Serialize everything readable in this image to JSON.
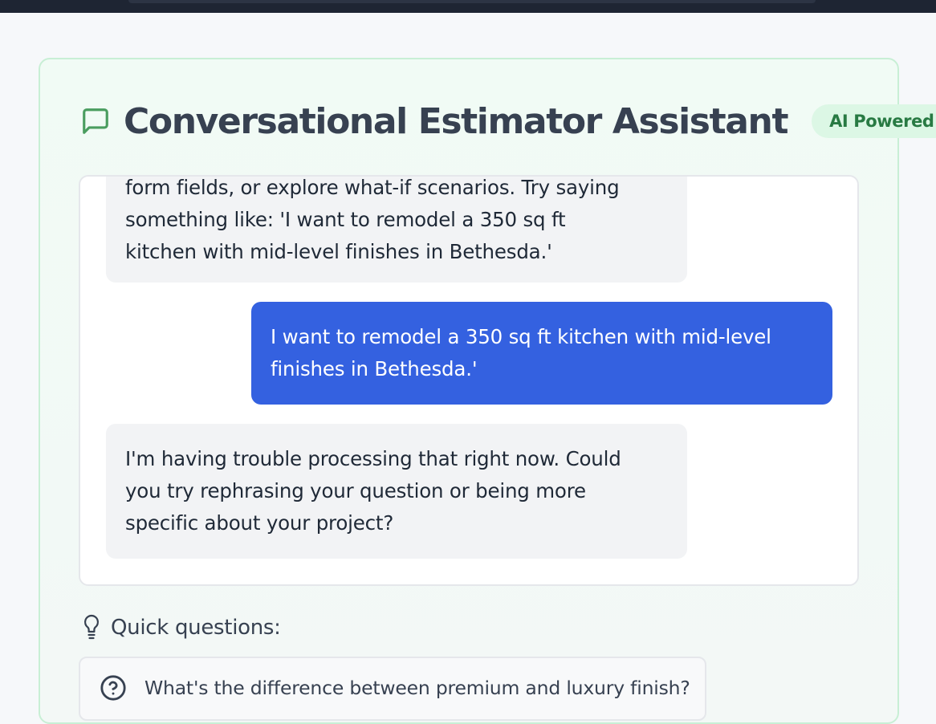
{
  "header": {
    "title": "Conversational Estimator Assistant",
    "badge": "AI Powered",
    "icon": "message-square-icon"
  },
  "chat": {
    "messages": [
      {
        "role": "assistant",
        "lines": [
          "form fields, or explore what-if scenarios. Try saying",
          "something like: 'I want to remodel a 350 sq ft",
          "kitchen with mid-level finishes in Bethesda.'"
        ]
      },
      {
        "role": "user",
        "lines": [
          "I want to remodel a 350 sq ft kitchen with mid-level",
          "finishes in Bethesda.'"
        ]
      },
      {
        "role": "assistant",
        "lines": [
          "I'm having trouble processing that right now. Could",
          "you try rephrasing your question or being more",
          "specific about your project?"
        ]
      }
    ]
  },
  "quick_questions": {
    "label": "Quick questions:",
    "icon": "lightbulb-icon",
    "items": [
      {
        "label": "What's the difference between premium and luxury finish?",
        "icon": "help-circle-icon"
      }
    ]
  },
  "colors": {
    "accent_green": "#4a9d5f",
    "user_bubble": "#3461e0",
    "assistant_bubble": "#f2f3f5",
    "badge_bg": "#dcf7e5",
    "badge_text": "#287a43"
  }
}
